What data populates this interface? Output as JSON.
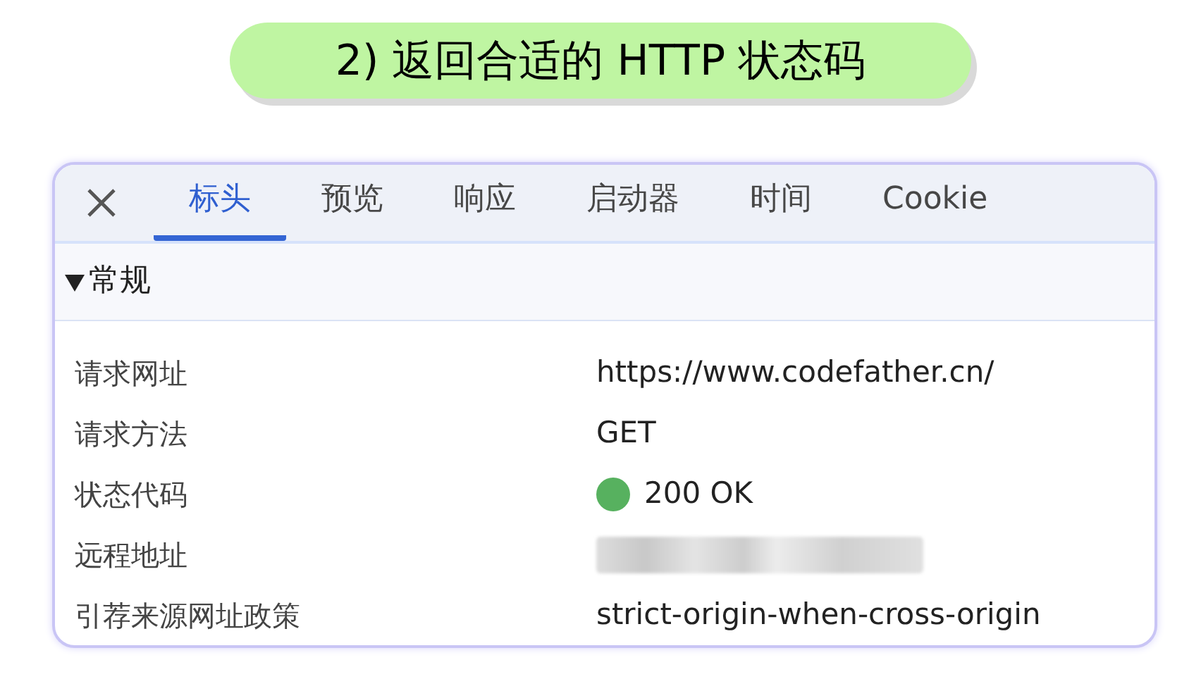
{
  "banner": {
    "title": "2) 返回合适的 HTTP 状态码"
  },
  "tabs": [
    {
      "label": "标头",
      "selected": true
    },
    {
      "label": "预览",
      "selected": false
    },
    {
      "label": "响应",
      "selected": false
    },
    {
      "label": "启动器",
      "selected": false
    },
    {
      "label": "时间",
      "selected": false
    },
    {
      "label": "Cookie",
      "selected": false
    }
  ],
  "section": {
    "title": "常规",
    "expanded": true
  },
  "rows": [
    {
      "kind": "text",
      "label": "请求网址",
      "value": "https://www.codefather.cn/"
    },
    {
      "kind": "text",
      "label": "请求方法",
      "value": "GET"
    },
    {
      "kind": "status",
      "label": "状态代码",
      "value": "200 OK",
      "color": "#57b15f"
    },
    {
      "kind": "redacted",
      "label": "远程地址"
    },
    {
      "kind": "text",
      "label": "引荐来源网址政策",
      "value": "strict-origin-when-cross-origin"
    }
  ]
}
